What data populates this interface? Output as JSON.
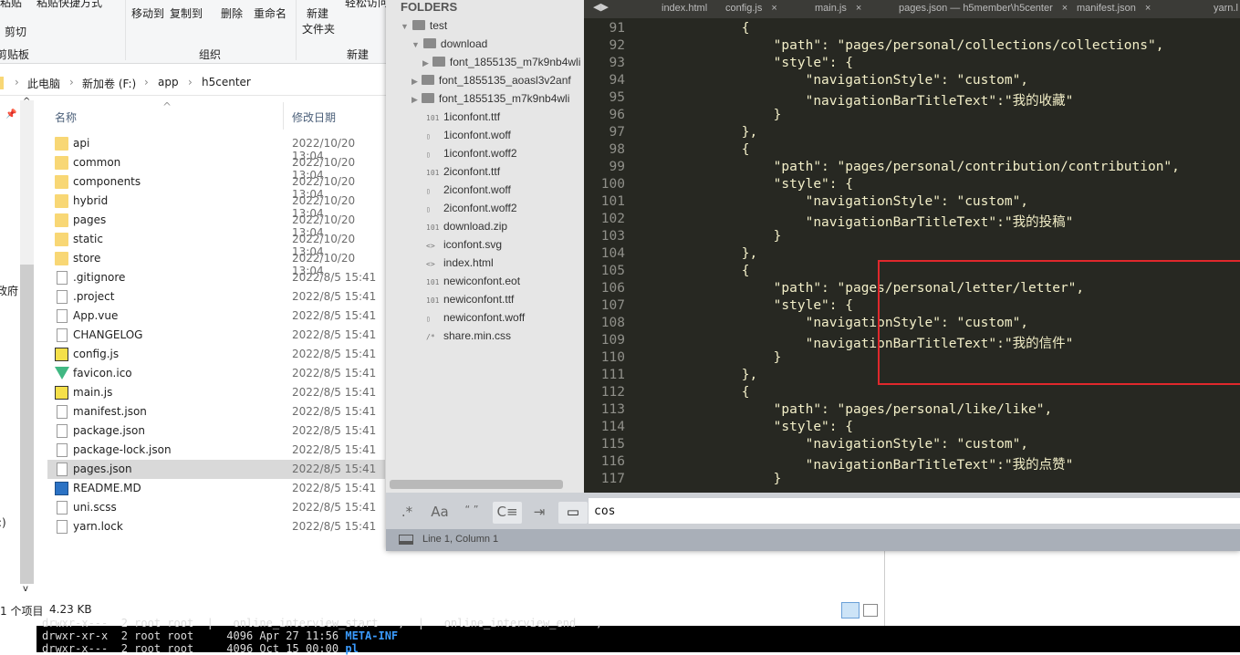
{
  "explorer": {
    "ribbon": {
      "paste": "粘贴",
      "paste_shortcut": "粘贴快捷方式",
      "cut": "剪切",
      "clipboard_group": "剪贴板",
      "move_to": "移动到",
      "copy_to": "复制到",
      "delete": "删除",
      "rename": "重命名",
      "organize_group": "组织",
      "new_folder_1": "新建",
      "new_folder_2": "文件夹",
      "new_group": "新建",
      "easy_access": "轻松访问"
    },
    "breadcrumb": [
      "此电脑",
      "新加卷 (F:)",
      "app",
      "h5center"
    ],
    "columns": {
      "name": "名称",
      "modified": "修改日期"
    },
    "nav_fragments": {
      "gov": "政府",
      "colon": ":)"
    },
    "files": [
      {
        "name": "api",
        "date": "2022/10/20 13:04",
        "type": "folder"
      },
      {
        "name": "common",
        "date": "2022/10/20 13:04",
        "type": "folder"
      },
      {
        "name": "components",
        "date": "2022/10/20 13:04",
        "type": "folder"
      },
      {
        "name": "hybrid",
        "date": "2022/10/20 13:04",
        "type": "folder"
      },
      {
        "name": "pages",
        "date": "2022/10/20 13:04",
        "type": "folder"
      },
      {
        "name": "static",
        "date": "2022/10/20 13:04",
        "type": "folder"
      },
      {
        "name": "store",
        "date": "2022/10/20 13:04",
        "type": "folder"
      },
      {
        "name": ".gitignore",
        "date": "2022/8/5 15:41",
        "type": "file"
      },
      {
        "name": ".project",
        "date": "2022/8/5 15:41",
        "type": "file"
      },
      {
        "name": "App.vue",
        "date": "2022/8/5 15:41",
        "type": "file"
      },
      {
        "name": "CHANGELOG",
        "date": "2022/8/5 15:41",
        "type": "file"
      },
      {
        "name": "config.js",
        "date": "2022/8/5 15:41",
        "type": "js"
      },
      {
        "name": "favicon.ico",
        "date": "2022/8/5 15:41",
        "type": "vue"
      },
      {
        "name": "main.js",
        "date": "2022/8/5 15:41",
        "type": "js"
      },
      {
        "name": "manifest.json",
        "date": "2022/8/5 15:41",
        "type": "file"
      },
      {
        "name": "package.json",
        "date": "2022/8/5 15:41",
        "type": "file"
      },
      {
        "name": "package-lock.json",
        "date": "2022/8/5 15:41",
        "type": "file"
      },
      {
        "name": "pages.json",
        "date": "2022/8/5 15:41",
        "type": "file",
        "selected": true
      },
      {
        "name": "README.MD",
        "date": "2022/8/5 15:41",
        "type": "md"
      },
      {
        "name": "uni.scss",
        "date": "2022/8/5 15:41",
        "type": "file"
      },
      {
        "name": "yarn.lock",
        "date": "2022/8/5 15:41",
        "type": "file"
      }
    ],
    "status": {
      "count": "1 个项目",
      "size": "4.23 KB"
    }
  },
  "sublime": {
    "sidebar": {
      "title": "FOLDERS",
      "items": [
        {
          "label": "test",
          "kind": "folder-open",
          "depth": 0
        },
        {
          "label": "download",
          "kind": "folder-open",
          "depth": 1
        },
        {
          "label": "font_1855135_m7k9nb4wli",
          "kind": "folder",
          "depth": 2
        },
        {
          "label": "font_1855135_aoasl3v2anf",
          "kind": "folder",
          "depth": 1
        },
        {
          "label": "font_1855135_m7k9nb4wli",
          "kind": "folder",
          "depth": 1
        },
        {
          "label": "1iconfont.ttf",
          "kind": "bin",
          "depth": 1
        },
        {
          "label": "1iconfont.woff",
          "kind": "file",
          "depth": 1
        },
        {
          "label": "1iconfont.woff2",
          "kind": "file",
          "depth": 1
        },
        {
          "label": "2iconfont.ttf",
          "kind": "bin",
          "depth": 1
        },
        {
          "label": "2iconfont.woff",
          "kind": "file",
          "depth": 1
        },
        {
          "label": "2iconfont.woff2",
          "kind": "file",
          "depth": 1
        },
        {
          "label": "download.zip",
          "kind": "bin",
          "depth": 1
        },
        {
          "label": "iconfont.svg",
          "kind": "code",
          "depth": 1
        },
        {
          "label": "index.html",
          "kind": "code",
          "depth": 1
        },
        {
          "label": "newiconfont.eot",
          "kind": "bin",
          "depth": 1
        },
        {
          "label": "newiconfont.ttf",
          "kind": "bin",
          "depth": 1
        },
        {
          "label": "newiconfont.woff",
          "kind": "file",
          "depth": 1
        },
        {
          "label": "share.min.css",
          "kind": "comment",
          "depth": 1
        }
      ]
    },
    "tabs": [
      {
        "label": "index.html",
        "close": ""
      },
      {
        "label": "config.js",
        "close": "×"
      },
      {
        "label": "main.js",
        "close": "×"
      },
      {
        "label": "pages.json — h5member\\h5center",
        "close": "×"
      },
      {
        "label": "manifest.json",
        "close": "×"
      },
      {
        "label": "yarn.l",
        "close": ""
      }
    ],
    "code": [
      {
        "n": "91",
        "t": "            {"
      },
      {
        "n": "92",
        "t": "                \"path\": \"pages/personal/collections/collections\","
      },
      {
        "n": "93",
        "t": "                \"style\": {"
      },
      {
        "n": "94",
        "t": "                    \"navigationStyle\": \"custom\","
      },
      {
        "n": "95",
        "t": "                    \"navigationBarTitleText\":\"我的收藏\""
      },
      {
        "n": "96",
        "t": "                }"
      },
      {
        "n": "97",
        "t": "            },"
      },
      {
        "n": "98",
        "t": "            {"
      },
      {
        "n": "99",
        "t": "                \"path\": \"pages/personal/contribution/contribution\","
      },
      {
        "n": "100",
        "t": "                \"style\": {"
      },
      {
        "n": "101",
        "t": "                    \"navigationStyle\": \"custom\","
      },
      {
        "n": "102",
        "t": "                    \"navigationBarTitleText\":\"我的投稿\""
      },
      {
        "n": "103",
        "t": "                }"
      },
      {
        "n": "104",
        "t": "            },"
      },
      {
        "n": "105",
        "t": "            {"
      },
      {
        "n": "106",
        "t": "                \"path\": \"pages/personal/letter/letter\","
      },
      {
        "n": "107",
        "t": "                \"style\": {"
      },
      {
        "n": "108",
        "t": "                    \"navigationStyle\": \"custom\","
      },
      {
        "n": "109",
        "t": "                    \"navigationBarTitleText\":\"我的信件\""
      },
      {
        "n": "110",
        "t": "                }"
      },
      {
        "n": "111",
        "t": "            },"
      },
      {
        "n": "112",
        "t": "            {"
      },
      {
        "n": "113",
        "t": "                \"path\": \"pages/personal/like/like\","
      },
      {
        "n": "114",
        "t": "                \"style\": {"
      },
      {
        "n": "115",
        "t": "                    \"navigationStyle\": \"custom\","
      },
      {
        "n": "116",
        "t": "                    \"navigationBarTitleText\":\"我的点赞\""
      },
      {
        "n": "117",
        "t": "                }"
      }
    ],
    "find": {
      "regex": ".*",
      "case": "Aa",
      "word": "“ ”",
      "wrap": "C≡",
      "in_selection": "⇥",
      "highlight": "▭",
      "query": "cos"
    },
    "status": "Line 1, Column 1"
  },
  "terminal": {
    "lines": [
      {
        "text": "drwxr-x---  2 root root  |   online_interview_start   ,  |   online_interview_end   ,",
        "dir": ""
      },
      {
        "text": "drwxr-xr-x  2 root root     4096 Apr 27 11:56 ",
        "dir": "META-INF"
      },
      {
        "text": "drwxr-x---  2 root root     4096 Oct 15 00:00 ",
        "dir": "pl"
      }
    ]
  },
  "colors": {
    "editor_bg": "#272822",
    "string": "#e6db74",
    "highlight_box": "#e0282c",
    "dir": "#3b9cff"
  }
}
